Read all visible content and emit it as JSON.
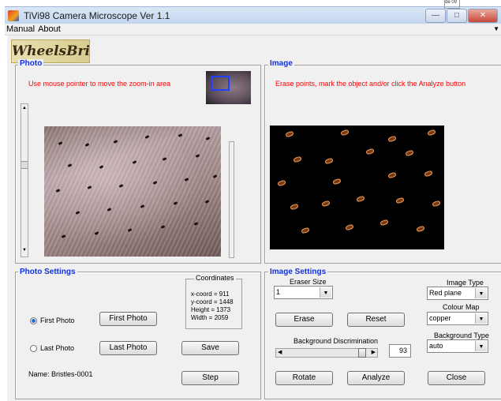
{
  "window": {
    "title": "TiVi98 Camera Microscope Ver 1.1"
  },
  "side_fragment": "de 09",
  "menu": {
    "items": [
      "Manual",
      "About"
    ]
  },
  "logo": "WheelsBridge",
  "photo_panel": {
    "title": "Photo",
    "instruction": "Use mouse pointer to move the zoom-in area"
  },
  "image_panel": {
    "title": "Image",
    "instruction": "Erase points, mark the object and/or click the Analyze button"
  },
  "photo_settings": {
    "title": "Photo Settings",
    "coordinates": {
      "title": "Coordinates",
      "x": "x-coord = 911",
      "y": "y-coord = 1448",
      "height": "Height = 1373",
      "width": "Width = 2059"
    },
    "first_photo_radio": "First Photo",
    "first_photo_button": "First Photo",
    "last_photo_radio": "Last Photo",
    "last_photo_button": "Last Photo",
    "save_button": "Save",
    "step_button": "Step",
    "name": "Name: Bristles-0001",
    "selected_radio": "First Photo"
  },
  "image_settings": {
    "title": "Image Settings",
    "eraser_size_label": "Eraser Size",
    "eraser_size_value": "1",
    "erase_button": "Erase",
    "reset_button": "Reset",
    "background_discrimination_label": "Background Discrimination",
    "background_discrimination_value": "93",
    "image_type_label": "Image Type",
    "image_type_value": "Red plane",
    "colour_map_label": "Colour Map",
    "colour_map_value": "copper",
    "background_type_label": "Background Type",
    "background_type_value": "auto",
    "rotate_button": "Rotate",
    "analyze_button": "Analyze",
    "close_button": "Close"
  },
  "colors": {
    "panel_title": "#1030e0",
    "instruction": "#ff0000",
    "panel_bg": "#f0f0f0"
  }
}
